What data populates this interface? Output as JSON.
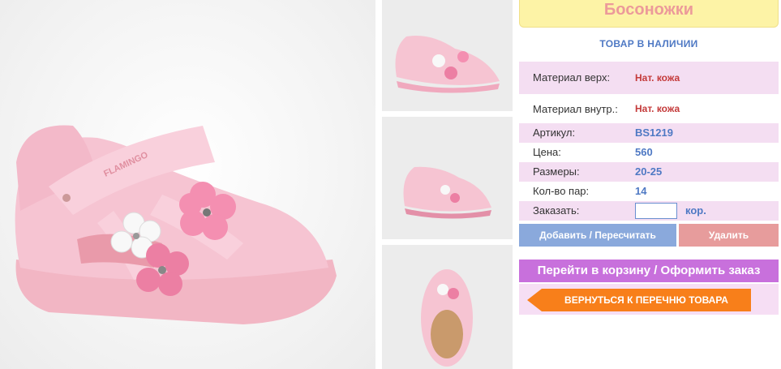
{
  "product": {
    "title": "Босоножки",
    "stock_status": "ТОВАР В НАЛИЧИИ",
    "brand_text": "FLAMINGO"
  },
  "details": {
    "material_top_label": "Материал верх:",
    "material_top_value": "Нат. кожа",
    "material_inner_label": "Материал внутр.:",
    "material_inner_value": "Нат. кожа",
    "article_label": "Артикул:",
    "article_value": "BS1219",
    "price_label": "Цена:",
    "price_value": "560",
    "sizes_label": "Размеры:",
    "sizes_value": "20-25",
    "pairs_label": "Кол-во пар:",
    "pairs_value": "14",
    "order_label": "Заказать:",
    "order_value": "",
    "order_unit": "кор."
  },
  "actions": {
    "add_label": "Добавить / Пересчитать",
    "delete_label": "Удалить",
    "cart_label": "Перейти в корзину / Оформить заказ",
    "back_label": "ВЕРНУТЬСЯ К ПЕРЕЧНЮ ТОВАРА"
  },
  "colors": {
    "title_bg": "#fdf3a6",
    "title_text": "#ec9a9a",
    "accent_blue": "#4f79c4",
    "accent_red": "#c43a3a",
    "row_pink": "#f4def2",
    "add_button": "#8aa9dc",
    "delete_button": "#e79c9c",
    "cart_button": "#c870dc",
    "back_button": "#f87f1a"
  },
  "icons": {
    "back_arrow": "arrow-left-icon"
  }
}
